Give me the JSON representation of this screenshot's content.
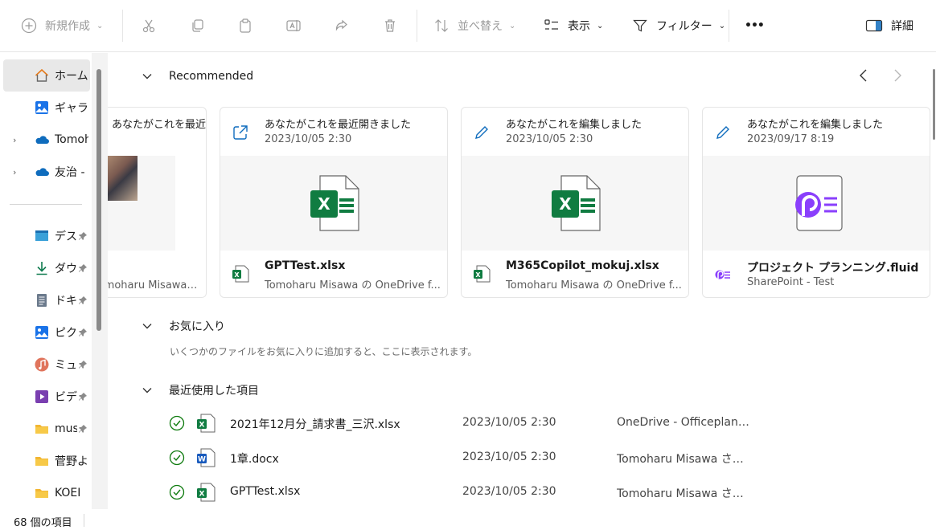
{
  "toolbar": {
    "new_label": "新規作成",
    "sort_label": "並べ替え",
    "view_label": "表示",
    "filter_label": "フィルター",
    "more_label": "•••",
    "details_label": "詳細"
  },
  "sidebar": {
    "items": [
      {
        "label": "ホーム"
      },
      {
        "label": "ギャラリー"
      },
      {
        "label": "Tomoharu"
      },
      {
        "label": "友治 -"
      },
      {
        "label": "デスクトップ"
      },
      {
        "label": "ダウンロード"
      },
      {
        "label": "ドキュメント"
      },
      {
        "label": "ピクチャ"
      },
      {
        "label": "ミュージック"
      },
      {
        "label": "ビデオ"
      },
      {
        "label": "music"
      },
      {
        "label": "菅野よう子"
      },
      {
        "label": "KOEI"
      }
    ]
  },
  "recommended": {
    "title": "Recommended",
    "cards": [
      {
        "activity": "あなたがこれを最近開きました",
        "date": "",
        "name": "",
        "location": "Tomoharu Misawa の OneDrive for..."
      },
      {
        "activity": "あなたがこれを最近開きました",
        "date": "2023/10/05 2:30",
        "name": "GPTTest.xlsx",
        "location": "Tomoharu Misawa の OneDrive f..."
      },
      {
        "activity": "あなたがこれを編集しました",
        "date": "2023/10/05 2:30",
        "name": "M365Copilot_mokuj.xlsx",
        "location": "Tomoharu Misawa の OneDrive f..."
      },
      {
        "activity": "あなたがこれを編集しました",
        "date": "2023/09/17 8:19",
        "name": "プロジェクト プランニング.fluid",
        "location": "SharePoint - Test"
      }
    ]
  },
  "favorites": {
    "title": "お気に入り",
    "empty_text": "いくつかのファイルをお気に入りに追加すると、ここに表示されます。"
  },
  "recent": {
    "title": "最近使用した項目",
    "rows": [
      {
        "name": "2021年12月分_請求書_三沢.xlsx",
        "date": "2023/10/05 2:30",
        "location": "OneDrive - Officeplann..."
      },
      {
        "name": "1章.docx",
        "date": "2023/10/05 2:30",
        "location": "Tomoharu Misawa さん..."
      },
      {
        "name": "GPTTest.xlsx",
        "date": "2023/10/05 2:30",
        "location": "Tomoharu Misawa さん..."
      }
    ]
  },
  "status": {
    "count": "68 個の項目"
  },
  "colors": {
    "excel": "#107c41",
    "word": "#185abd",
    "onedrive": "#0f6cbd",
    "loop": "#8a3ffc",
    "synced": "#0f7b0f"
  }
}
